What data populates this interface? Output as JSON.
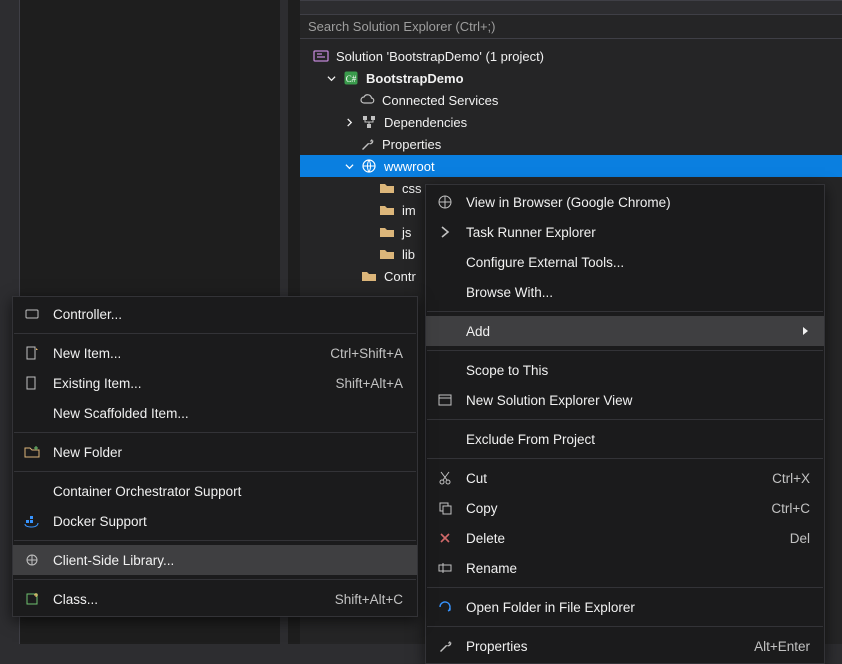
{
  "search_placeholder": "Search Solution Explorer (Ctrl+;)",
  "tree": {
    "solution_label": "Solution 'BootstrapDemo' (1 project)",
    "project_label": "BootstrapDemo",
    "connected_services": "Connected Services",
    "dependencies": "Dependencies",
    "properties": "Properties",
    "wwwroot": "wwwroot",
    "css": "css",
    "images": "im",
    "js": "js",
    "lib": "lib",
    "controllers": "Contr"
  },
  "menu1": {
    "view_browser": "View in Browser (Google Chrome)",
    "task_runner": "Task Runner Explorer",
    "config_ext": "Configure External Tools...",
    "browse_with": "Browse With...",
    "add": "Add",
    "scope": "Scope to This",
    "new_view": "New Solution Explorer View",
    "exclude": "Exclude From Project",
    "cut": "Cut",
    "cut_short": "Ctrl+X",
    "copy": "Copy",
    "copy_short": "Ctrl+C",
    "delete": "Delete",
    "delete_short": "Del",
    "rename": "Rename",
    "open_folder": "Open Folder in File Explorer",
    "properties": "Properties",
    "properties_short": "Alt+Enter"
  },
  "menu2": {
    "controller": "Controller...",
    "new_item": "New Item...",
    "new_item_short": "Ctrl+Shift+A",
    "existing_item": "Existing Item...",
    "existing_item_short": "Shift+Alt+A",
    "scaffold": "New Scaffolded Item...",
    "new_folder": "New Folder",
    "container": "Container Orchestrator Support",
    "docker": "Docker Support",
    "client_lib": "Client-Side Library...",
    "class": "Class...",
    "class_short": "Shift+Alt+C"
  }
}
